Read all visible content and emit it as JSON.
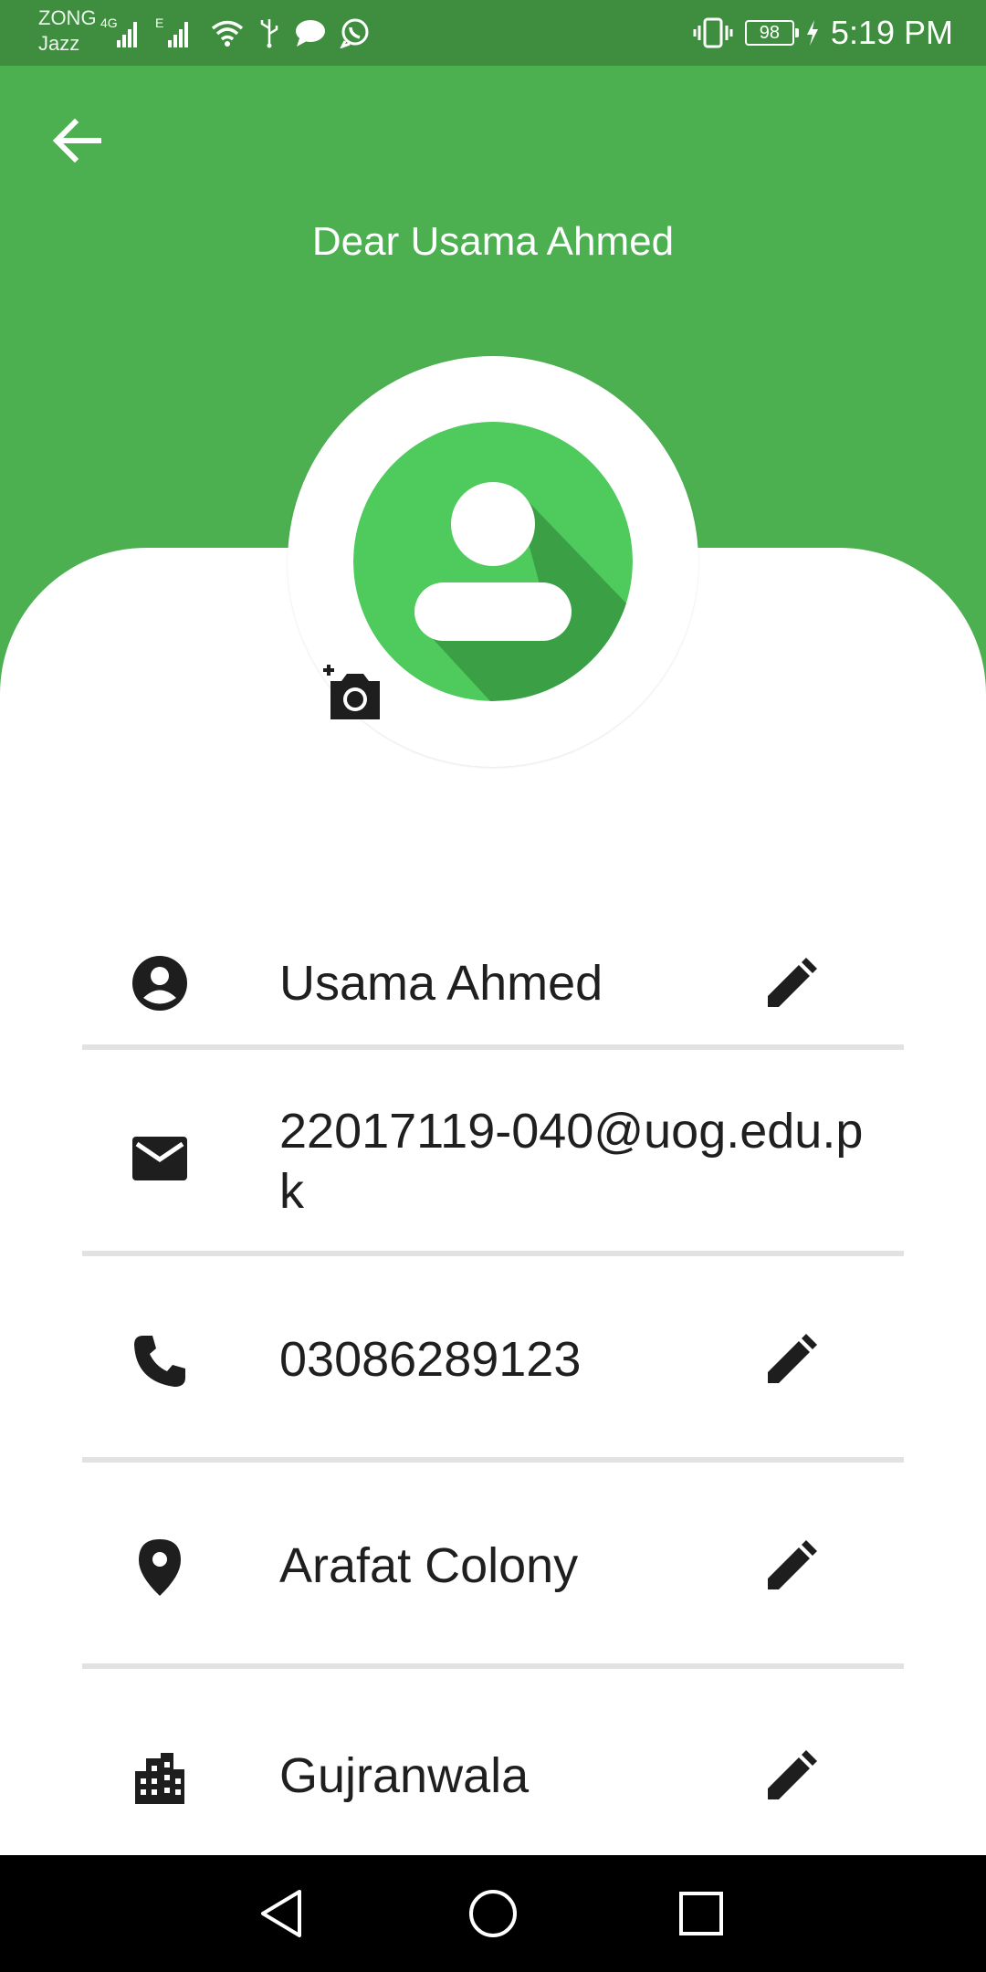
{
  "status_bar": {
    "carrier_primary": "ZONG",
    "carrier_secondary": "Jazz",
    "network_type": "4G",
    "network_type_2": "E",
    "battery_level": "98",
    "time": "5:19 PM",
    "icons": [
      "signal-icon",
      "signal-icon",
      "wifi-icon",
      "usb-icon",
      "message-icon",
      "whatsapp-icon",
      "vibrate-icon",
      "battery-icon",
      "charging-icon"
    ]
  },
  "header": {
    "title": "Dear Usama Ahmed",
    "back_icon": "arrow-left-icon"
  },
  "avatar": {
    "icon": "account-avatar-icon",
    "camera_icon": "add-photo-icon"
  },
  "profile": {
    "rows": [
      {
        "icon": "account-circle-icon",
        "value": "Usama Ahmed",
        "editable": true
      },
      {
        "icon": "email-icon",
        "value": "22017119-040@uog.edu.pk",
        "editable": false
      },
      {
        "icon": "phone-icon",
        "value": "03086289123",
        "editable": true
      },
      {
        "icon": "location-pin-icon",
        "value": "Arafat Colony",
        "editable": true
      },
      {
        "icon": "city-icon",
        "value": "Gujranwala",
        "editable": true
      }
    ]
  },
  "nav_bar": {
    "buttons": [
      "back-triangle-icon",
      "home-circle-icon",
      "recents-square-icon"
    ]
  },
  "colors": {
    "status_bar": "#3f8e3f",
    "header": "#4caf50",
    "avatar_bg": "#4fca5c",
    "avatar_shadow": "#3a9f45",
    "divider": "#e2e2e2",
    "text": "#1f1f1f"
  }
}
